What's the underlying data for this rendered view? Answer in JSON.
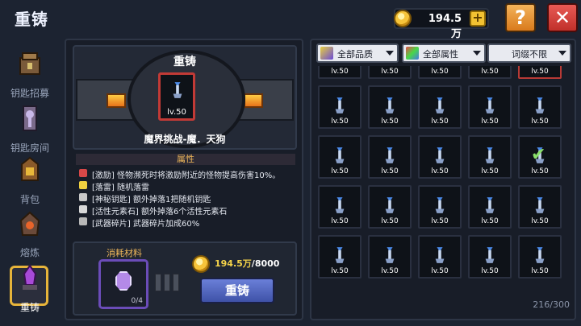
{
  "header": {
    "title": "重铸",
    "currency": "194.5万",
    "plus_label": "+",
    "help_label": "?",
    "close_label": "✕"
  },
  "sidebar": {
    "items": [
      {
        "label": "钥匙招募",
        "icon": "key-recruit-icon"
      },
      {
        "label": "钥匙房间",
        "icon": "key-room-icon"
      },
      {
        "label": "背包",
        "icon": "backpack-icon"
      },
      {
        "label": "熔炼",
        "icon": "smelt-icon"
      },
      {
        "label": "重铸",
        "icon": "reforge-icon",
        "active": true
      }
    ]
  },
  "reforge": {
    "machine_title": "重铸",
    "slot_level": "lv.50",
    "item_name": "魔界挑战-魔．天狗",
    "attributes_header": "属性",
    "attributes": [
      {
        "text": "[激励] 怪物濒死时将激励附近的怪物提高伤害10%。",
        "color": "#d84848"
      },
      {
        "text": "[落雷] 随机落雷",
        "color": "#f0d040"
      },
      {
        "text": "[神秘钥匙] 额外掉落1把随机钥匙",
        "color": "#e8e8e8"
      },
      {
        "text": "[活性元素石] 额外掉落6个活性元素石",
        "color": "#e8e8e8"
      },
      {
        "text": "[武器碎片] 武器碎片加成60%",
        "color": "#e8e8e8"
      }
    ],
    "materials_label": "消耗材料",
    "material_count": "0/4",
    "cost_owned": "194.5万",
    "cost_required": "/8000",
    "reforge_button": "重铸"
  },
  "filters": {
    "quality": "全部品质",
    "attribute": "全部属性",
    "affix": "词缀不限"
  },
  "inventory": {
    "cell_level": "lv.50",
    "count": "216/300"
  },
  "colors": {
    "accent_gold": "#f2c232",
    "reforge_blue": "#4a5fc0",
    "slot_red": "#c23a36",
    "material_purple": "#6b4cb8"
  }
}
